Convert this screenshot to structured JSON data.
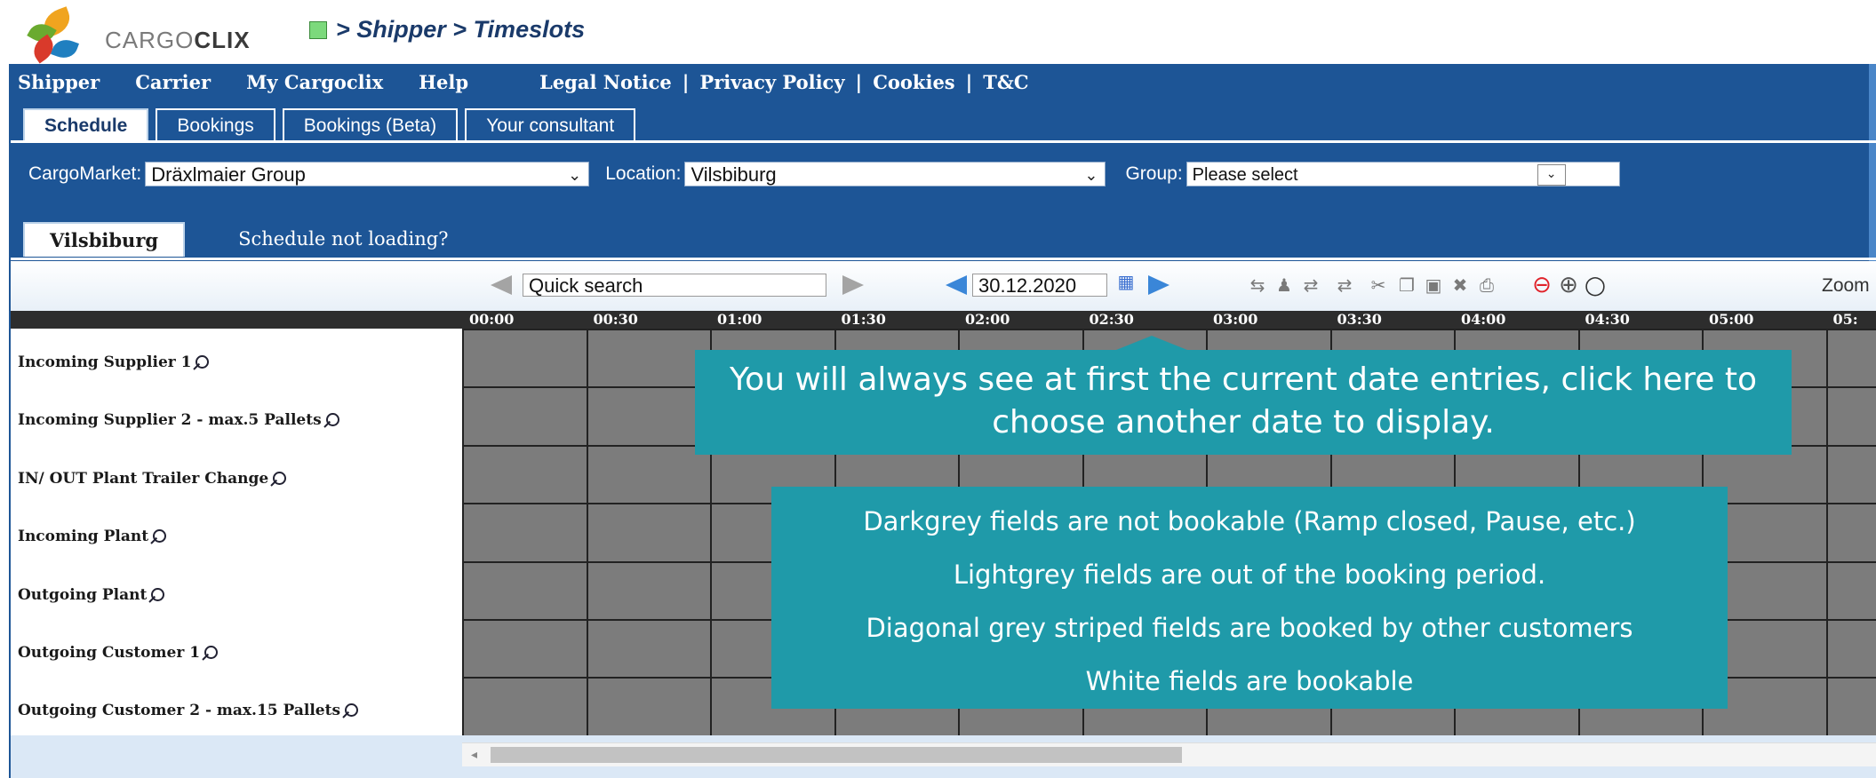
{
  "header": {
    "brand_light": "CARGO",
    "brand_bold": "CLIX",
    "breadcrumb": "> Shipper > Timeslots"
  },
  "menu": {
    "items": [
      "Shipper",
      "Carrier",
      "My Cargoclix",
      "Help"
    ],
    "legal": [
      "Legal Notice",
      "Privacy Policy",
      "Cookies",
      "T&C"
    ],
    "separator": "|"
  },
  "tabs": [
    "Schedule",
    "Bookings",
    "Bookings (Beta)",
    "Your consultant"
  ],
  "filters": {
    "cargomarket_label": "CargoMarket:",
    "cargomarket_value": "Dräxlmaier Group",
    "location_label": "Location:",
    "location_value": "Vilsbiburg",
    "group_label": "Group:",
    "group_value": "Please select"
  },
  "location_tab": "Vilsbiburg",
  "schedule_help_link": "Schedule not loading?",
  "toolbar": {
    "quick_search_placeholder": "Quick search",
    "date": "30.12.2020",
    "zoom_label": "Zoom"
  },
  "times": [
    "00:00",
    "00:30",
    "01:00",
    "01:30",
    "02:00",
    "02:30",
    "03:00",
    "03:30",
    "04:00",
    "04:30",
    "05:00",
    "05:"
  ],
  "rows": [
    "Incoming Supplier 1",
    "Incoming Supplier 2 - max.5 Pallets",
    "IN/ OUT Plant Trailer Change",
    "Incoming Plant",
    "Outgoing Plant",
    "Outgoing Customer 1",
    "Outgoing Customer 2 - max.15 Pallets"
  ],
  "callouts": {
    "date_hint": "You will always see at first the current date entries, click here to choose another date to display.",
    "legend": [
      "Darkgrey fields are not bookable (Ramp closed, Pause, etc.)",
      "Lightgrey fields are out of the booking period.",
      "Diagonal grey striped fields are booked by other customers",
      "White fields are bookable"
    ]
  },
  "colors": {
    "nav_blue": "#1d5596",
    "callout_teal": "#1f9aa9",
    "grid_dark": "#7c7c7c",
    "breadcrumb_square": "#7cd97c"
  },
  "icons": [
    "calendar-icon",
    "transfer-icons",
    "cut-icon",
    "copy-icon",
    "paste-icon",
    "delete-icon",
    "print-icon",
    "status-red-icon",
    "globe-icon",
    "circle-icon"
  ]
}
